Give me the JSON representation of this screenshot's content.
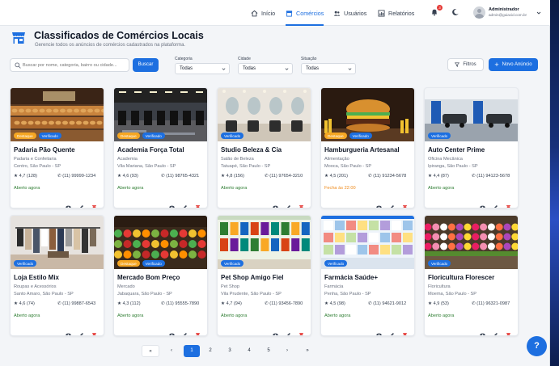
{
  "nav": {
    "items": [
      {
        "label": "Início",
        "icon": "home-icon"
      },
      {
        "label": "Comércios",
        "icon": "store-icon"
      },
      {
        "label": "Usuários",
        "icon": "users-icon"
      },
      {
        "label": "Relatórios",
        "icon": "chart-icon"
      }
    ],
    "active_index": 1,
    "notification_count": "3",
    "user": {
      "name": "Administrador",
      "email": "admin@guiacid.com.br"
    }
  },
  "header": {
    "title": "Classificados de Comércios Locais",
    "subtitle": "Gerencie todos os anúncios de comércios cadastrados na plataforma."
  },
  "filters": {
    "search_placeholder": "Buscar por nome, categoria, bairro ou cidade...",
    "search_button": "Buscar",
    "category_label": "Categoria",
    "category_value": "Todas",
    "city_label": "Cidade",
    "city_value": "Todas",
    "status_label": "Situação",
    "status_value": "Todas",
    "filters_button": "Filtros",
    "new_button": "Novo Anúncio"
  },
  "badges": {
    "featured": "Destaque",
    "verified": "Verificado"
  },
  "listings": [
    {
      "name": "Padaria Pão Quente",
      "category": "Padaria e Confeitaria",
      "location": "Centro, São Paulo - SP",
      "rating": "4,7 (128)",
      "phone": "(11) 99999-1234",
      "status": "Aberto agora",
      "open": true,
      "featured": true,
      "verified": true,
      "scene": "bakery"
    },
    {
      "name": "Academia Força Total",
      "category": "Academia",
      "location": "Vila Mariana, São Paulo - SP",
      "rating": "4,6 (93)",
      "phone": "(11) 98765-4321",
      "status": "Aberto agora",
      "open": true,
      "featured": true,
      "verified": true,
      "scene": "gym"
    },
    {
      "name": "Studio Beleza & Cia",
      "category": "Salão de Beleza",
      "location": "Tatuapé, São Paulo - SP",
      "rating": "4,8 (156)",
      "phone": "(11) 97654-3210",
      "status": "Aberto agora",
      "open": true,
      "featured": false,
      "verified": true,
      "scene": "salon"
    },
    {
      "name": "Hamburgueria Artesanal",
      "category": "Alimentação",
      "location": "Mooca, São Paulo - SP",
      "rating": "4,5 (201)",
      "phone": "(11) 91234-5678",
      "status": "Fecha às 22:00",
      "open": false,
      "featured": true,
      "verified": true,
      "scene": "burger"
    },
    {
      "name": "Auto Center Prime",
      "category": "Oficina Mecânica",
      "location": "Ipiranga, São Paulo - SP",
      "rating": "4,4 (87)",
      "phone": "(11) 94123-5678",
      "status": "Aberto agora",
      "open": true,
      "featured": false,
      "verified": true,
      "scene": "garage"
    },
    {
      "name": "Loja Estilo Mix",
      "category": "Roupas e Acessórios",
      "location": "Santo Amaro, São Paulo - SP",
      "rating": "4,6 (74)",
      "phone": "(11) 99887-6543",
      "status": "Aberto agora",
      "open": true,
      "featured": false,
      "verified": true,
      "scene": "clothes"
    },
    {
      "name": "Mercado Bom Preço",
      "category": "Mercado",
      "location": "Jabaquara, São Paulo - SP",
      "rating": "4,3 (112)",
      "phone": "(11) 95555-7890",
      "status": "Aberto agora",
      "open": true,
      "featured": true,
      "verified": true,
      "scene": "market"
    },
    {
      "name": "Pet Shop Amigo Fiel",
      "category": "Pet Shop",
      "location": "Vila Prudente, São Paulo - SP",
      "rating": "4,7 (94)",
      "phone": "(11) 93456-7890",
      "status": "Aberto agora",
      "open": true,
      "featured": false,
      "verified": true,
      "scene": "petshop"
    },
    {
      "name": "Farmácia Saúde+",
      "category": "Farmácia",
      "location": "Penha, São Paulo - SP",
      "rating": "4,5 (98)",
      "phone": "(11) 94621-9012",
      "status": "Aberto agora",
      "open": true,
      "featured": false,
      "verified": true,
      "scene": "pharmacy"
    },
    {
      "name": "Floricultura Florescer",
      "category": "Floricultura",
      "location": "Moema, São Paulo - SP",
      "rating": "4,9 (53)",
      "phone": "(11) 96321-0987",
      "status": "Aberto agora",
      "open": true,
      "featured": false,
      "verified": true,
      "scene": "flowers"
    }
  ],
  "pagination": {
    "first": "«",
    "prev": "‹",
    "pages": [
      "1",
      "2",
      "3",
      "4",
      "5"
    ],
    "active": "1",
    "next": "›",
    "last": "»"
  },
  "help_label": "?",
  "colors": {
    "primary": "#1d6fe0",
    "featured": "#f5a623",
    "open": "#2e7d32",
    "closing": "#ef8a1a",
    "delete": "#e53935"
  }
}
